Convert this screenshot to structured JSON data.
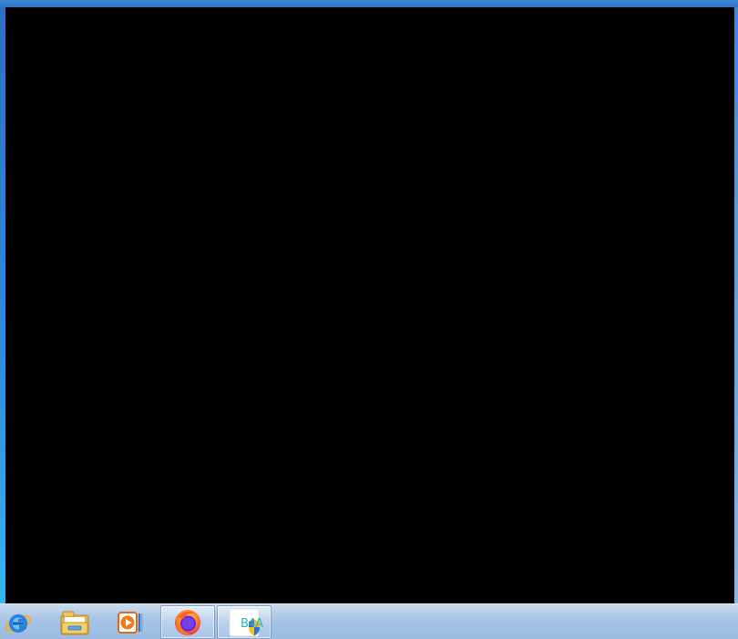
{
  "window": {
    "content_color": "#000000",
    "frame_color": "#2a6fc9"
  },
  "taskbar": {
    "background": "#a7c3e6",
    "items": [
      {
        "name": "internet-explorer",
        "icon": "internet-explorer-icon",
        "active": false
      },
      {
        "name": "file-explorer",
        "icon": "folder-icon",
        "active": false
      },
      {
        "name": "media-player",
        "icon": "media-player-icon",
        "active": false
      },
      {
        "name": "firefox",
        "icon": "firefox-icon",
        "active": true
      },
      {
        "name": "b4a",
        "icon": "b4a-icon",
        "label": "B4A",
        "active": true
      }
    ]
  }
}
